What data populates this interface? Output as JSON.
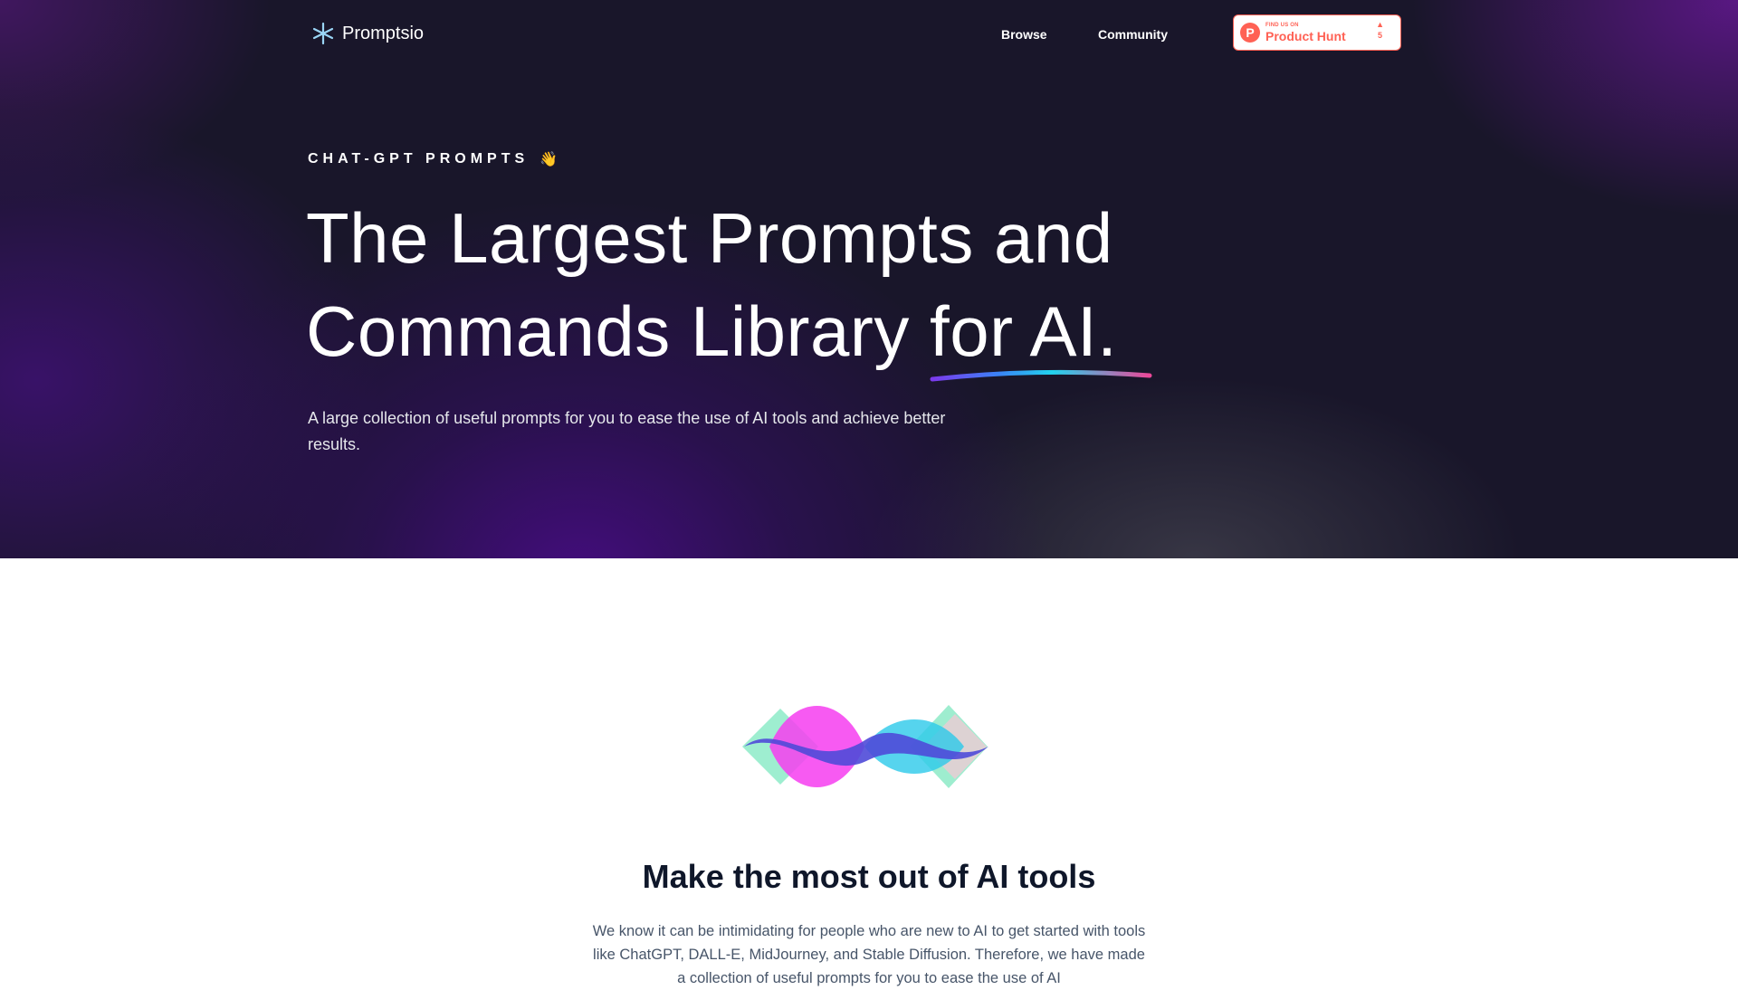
{
  "brand": {
    "name": "Promptsio",
    "logo_icon": "sparkle-star-icon",
    "accent_color": "#7dd3fc"
  },
  "nav": {
    "browse_label": "Browse",
    "community_label": "Community"
  },
  "product_hunt": {
    "small_text": "FIND US ON",
    "big_text": "Product Hunt",
    "votes": "5",
    "upvote_icon": "upvote-triangle-icon",
    "color": "#ff6154"
  },
  "hero": {
    "eyebrow": "CHAT-GPT PROMPTS",
    "eyebrow_emoji": "👋",
    "title_line1": "The Largest Prompts and",
    "title_line2": "Commands Library for AI.",
    "subtitle": "A large collection of useful prompts for you to ease the use of AI tools and achieve better results.",
    "underline_colors": [
      "#7c3aed",
      "#22d3ee",
      "#ec4899"
    ]
  },
  "feature": {
    "title": "Make the most out of AI tools",
    "text": "We know it can be intimidating for people who are new to AI to get started with tools like ChatGPT, DALL-E, MidJourney, and Stable Diffusion. Therefore, we have made a collection of useful prompts for you to ease the use of AI"
  }
}
